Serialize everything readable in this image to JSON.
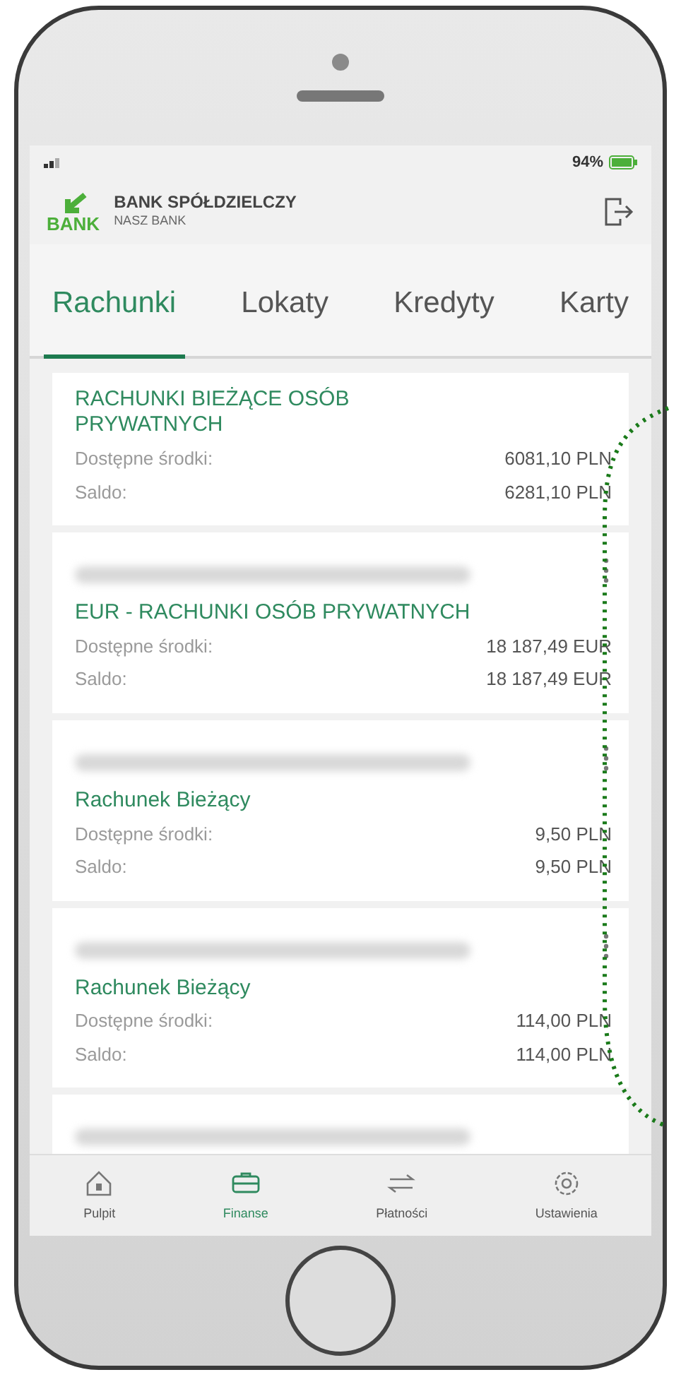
{
  "status_bar": {
    "battery": "94%"
  },
  "header": {
    "logo_text": "BANK",
    "title": "BANK SPÓŁDZIELCZY",
    "subtitle": "NASZ BANK"
  },
  "tabs": [
    {
      "label": "Rachunki",
      "selected": true
    },
    {
      "label": "Lokaty",
      "selected": false
    },
    {
      "label": "Kredyty",
      "selected": false
    },
    {
      "label": "Karty",
      "selected": false
    }
  ],
  "accounts": [
    {
      "name": "RACHUNKI BIEŻĄCE OSÓB PRYWATNYCH",
      "masked_number": false,
      "menu": false,
      "rows": [
        {
          "label": "Dostępne środki:",
          "value": "6081,10 PLN"
        },
        {
          "label": "Saldo:",
          "value": "6281,10 PLN"
        }
      ]
    },
    {
      "name": "EUR - RACHUNKI OSÓB PRYWATNYCH",
      "masked_number": true,
      "menu": true,
      "rows": [
        {
          "label": "Dostępne środki:",
          "value": "18 187,49 EUR"
        },
        {
          "label": "Saldo:",
          "value": "18 187,49 EUR"
        }
      ]
    },
    {
      "name": "Rachunek Bieżący",
      "masked_number": true,
      "menu": true,
      "rows": [
        {
          "label": "Dostępne środki:",
          "value": "9,50 PLN"
        },
        {
          "label": "Saldo:",
          "value": "9,50 PLN"
        }
      ]
    },
    {
      "name": "Rachunek Bieżący",
      "masked_number": true,
      "menu": true,
      "rows": [
        {
          "label": "Dostępne środki:",
          "value": "114,00 PLN"
        },
        {
          "label": "Saldo:",
          "value": "114,00 PLN"
        }
      ]
    }
  ],
  "nav": [
    {
      "label": "Pulpit",
      "selected": false
    },
    {
      "label": "Finanse",
      "selected": true
    },
    {
      "label": "Płatności",
      "selected": false
    },
    {
      "label": "Ustawienia",
      "selected": false
    }
  ]
}
